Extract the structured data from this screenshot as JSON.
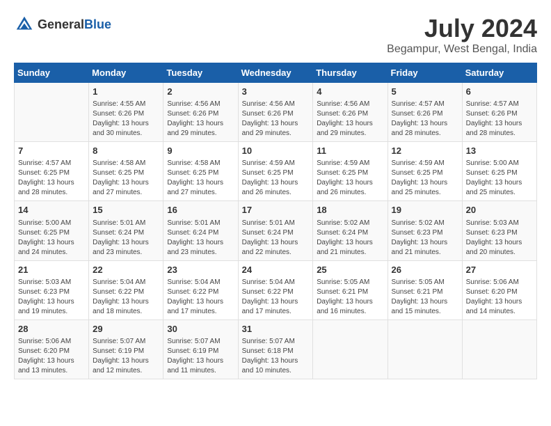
{
  "header": {
    "logo_general": "General",
    "logo_blue": "Blue",
    "month_year": "July 2024",
    "location": "Begampur, West Bengal, India"
  },
  "calendar": {
    "days_of_week": [
      "Sunday",
      "Monday",
      "Tuesday",
      "Wednesday",
      "Thursday",
      "Friday",
      "Saturday"
    ],
    "weeks": [
      [
        {
          "day": "",
          "info": ""
        },
        {
          "day": "1",
          "info": "Sunrise: 4:55 AM\nSunset: 6:26 PM\nDaylight: 13 hours\nand 30 minutes."
        },
        {
          "day": "2",
          "info": "Sunrise: 4:56 AM\nSunset: 6:26 PM\nDaylight: 13 hours\nand 29 minutes."
        },
        {
          "day": "3",
          "info": "Sunrise: 4:56 AM\nSunset: 6:26 PM\nDaylight: 13 hours\nand 29 minutes."
        },
        {
          "day": "4",
          "info": "Sunrise: 4:56 AM\nSunset: 6:26 PM\nDaylight: 13 hours\nand 29 minutes."
        },
        {
          "day": "5",
          "info": "Sunrise: 4:57 AM\nSunset: 6:26 PM\nDaylight: 13 hours\nand 28 minutes."
        },
        {
          "day": "6",
          "info": "Sunrise: 4:57 AM\nSunset: 6:26 PM\nDaylight: 13 hours\nand 28 minutes."
        }
      ],
      [
        {
          "day": "7",
          "info": "Sunrise: 4:57 AM\nSunset: 6:25 PM\nDaylight: 13 hours\nand 28 minutes."
        },
        {
          "day": "8",
          "info": "Sunrise: 4:58 AM\nSunset: 6:25 PM\nDaylight: 13 hours\nand 27 minutes."
        },
        {
          "day": "9",
          "info": "Sunrise: 4:58 AM\nSunset: 6:25 PM\nDaylight: 13 hours\nand 27 minutes."
        },
        {
          "day": "10",
          "info": "Sunrise: 4:59 AM\nSunset: 6:25 PM\nDaylight: 13 hours\nand 26 minutes."
        },
        {
          "day": "11",
          "info": "Sunrise: 4:59 AM\nSunset: 6:25 PM\nDaylight: 13 hours\nand 26 minutes."
        },
        {
          "day": "12",
          "info": "Sunrise: 4:59 AM\nSunset: 6:25 PM\nDaylight: 13 hours\nand 25 minutes."
        },
        {
          "day": "13",
          "info": "Sunrise: 5:00 AM\nSunset: 6:25 PM\nDaylight: 13 hours\nand 25 minutes."
        }
      ],
      [
        {
          "day": "14",
          "info": "Sunrise: 5:00 AM\nSunset: 6:25 PM\nDaylight: 13 hours\nand 24 minutes."
        },
        {
          "day": "15",
          "info": "Sunrise: 5:01 AM\nSunset: 6:24 PM\nDaylight: 13 hours\nand 23 minutes."
        },
        {
          "day": "16",
          "info": "Sunrise: 5:01 AM\nSunset: 6:24 PM\nDaylight: 13 hours\nand 23 minutes."
        },
        {
          "day": "17",
          "info": "Sunrise: 5:01 AM\nSunset: 6:24 PM\nDaylight: 13 hours\nand 22 minutes."
        },
        {
          "day": "18",
          "info": "Sunrise: 5:02 AM\nSunset: 6:24 PM\nDaylight: 13 hours\nand 21 minutes."
        },
        {
          "day": "19",
          "info": "Sunrise: 5:02 AM\nSunset: 6:23 PM\nDaylight: 13 hours\nand 21 minutes."
        },
        {
          "day": "20",
          "info": "Sunrise: 5:03 AM\nSunset: 6:23 PM\nDaylight: 13 hours\nand 20 minutes."
        }
      ],
      [
        {
          "day": "21",
          "info": "Sunrise: 5:03 AM\nSunset: 6:23 PM\nDaylight: 13 hours\nand 19 minutes."
        },
        {
          "day": "22",
          "info": "Sunrise: 5:04 AM\nSunset: 6:22 PM\nDaylight: 13 hours\nand 18 minutes."
        },
        {
          "day": "23",
          "info": "Sunrise: 5:04 AM\nSunset: 6:22 PM\nDaylight: 13 hours\nand 17 minutes."
        },
        {
          "day": "24",
          "info": "Sunrise: 5:04 AM\nSunset: 6:22 PM\nDaylight: 13 hours\nand 17 minutes."
        },
        {
          "day": "25",
          "info": "Sunrise: 5:05 AM\nSunset: 6:21 PM\nDaylight: 13 hours\nand 16 minutes."
        },
        {
          "day": "26",
          "info": "Sunrise: 5:05 AM\nSunset: 6:21 PM\nDaylight: 13 hours\nand 15 minutes."
        },
        {
          "day": "27",
          "info": "Sunrise: 5:06 AM\nSunset: 6:20 PM\nDaylight: 13 hours\nand 14 minutes."
        }
      ],
      [
        {
          "day": "28",
          "info": "Sunrise: 5:06 AM\nSunset: 6:20 PM\nDaylight: 13 hours\nand 13 minutes."
        },
        {
          "day": "29",
          "info": "Sunrise: 5:07 AM\nSunset: 6:19 PM\nDaylight: 13 hours\nand 12 minutes."
        },
        {
          "day": "30",
          "info": "Sunrise: 5:07 AM\nSunset: 6:19 PM\nDaylight: 13 hours\nand 11 minutes."
        },
        {
          "day": "31",
          "info": "Sunrise: 5:07 AM\nSunset: 6:18 PM\nDaylight: 13 hours\nand 10 minutes."
        },
        {
          "day": "",
          "info": ""
        },
        {
          "day": "",
          "info": ""
        },
        {
          "day": "",
          "info": ""
        }
      ]
    ]
  }
}
